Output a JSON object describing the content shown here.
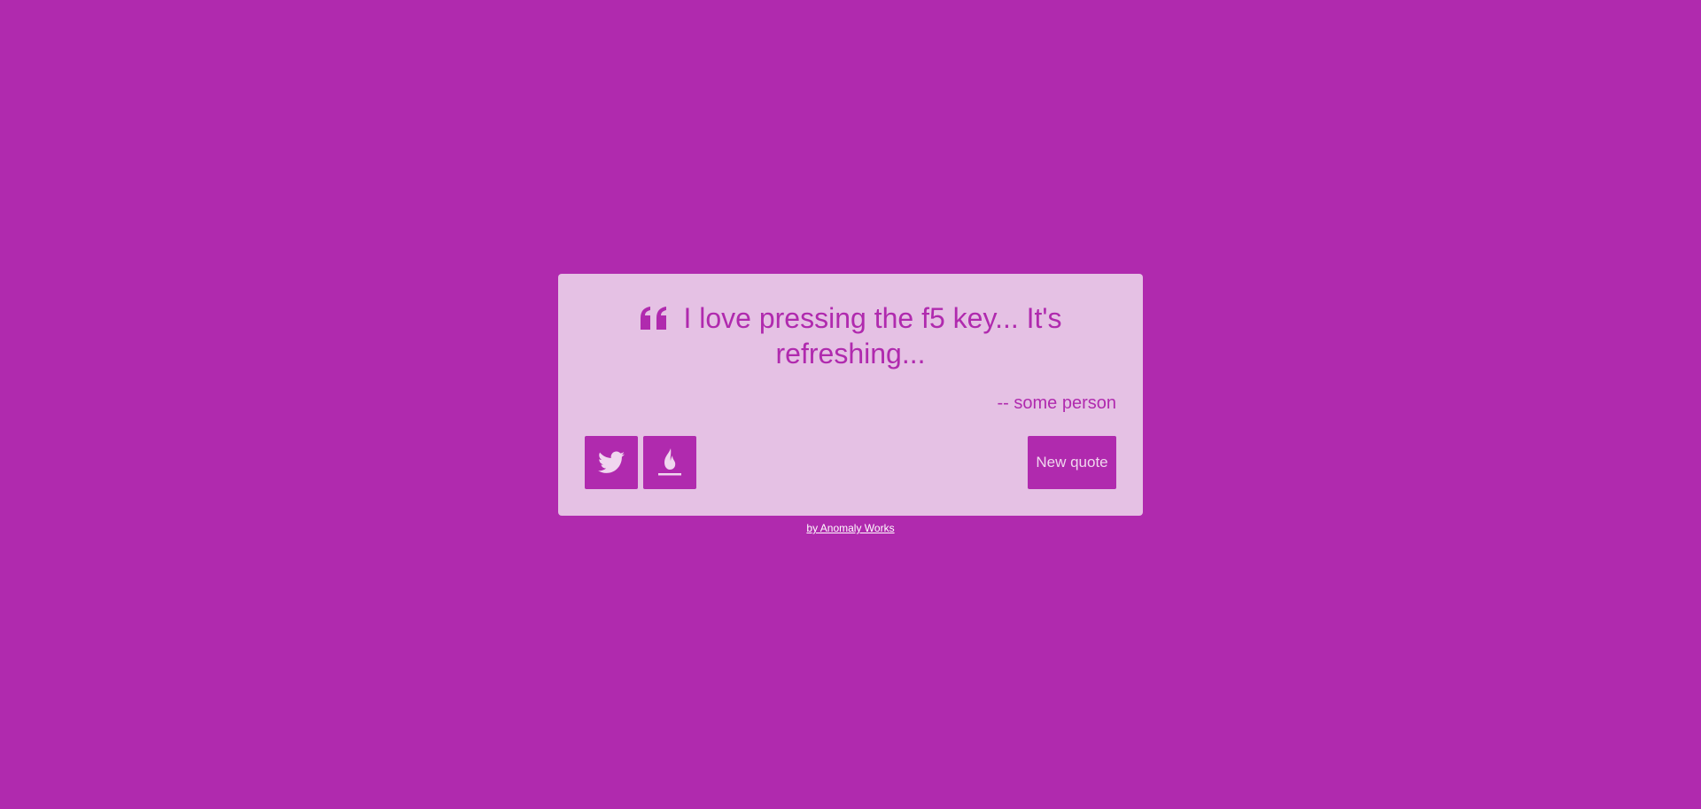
{
  "colors": {
    "background": "#b02aae",
    "card": "#e5c1e4",
    "accent": "#b02aae",
    "button_text": "#f0d6ef",
    "footer_link": "#ffffff"
  },
  "quote": {
    "icon": "quote-left-icon",
    "text": "I love pressing the f5 key... It's refreshing...",
    "author": "-- some person"
  },
  "actions": {
    "tweet_icon": "twitter-icon",
    "tumblr_icon": "fire-icon",
    "new_quote_label": "New quote"
  },
  "footer": {
    "credit": "by Anomaly Works"
  }
}
